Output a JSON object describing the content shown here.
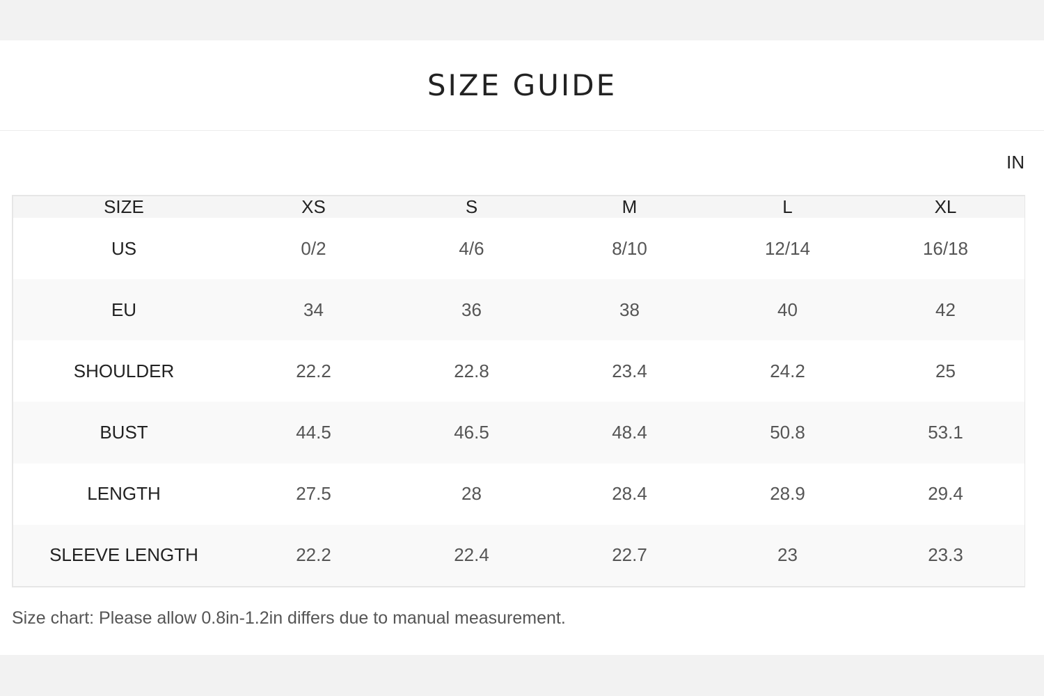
{
  "page": {
    "title": "SIZE GUIDE",
    "unit": "IN"
  },
  "table": {
    "headers": [
      "SIZE",
      "XS",
      "S",
      "M",
      "L",
      "XL"
    ],
    "rows": [
      {
        "label": "US",
        "values": [
          "0/2",
          "4/6",
          "8/10",
          "12/14",
          "16/18"
        ]
      },
      {
        "label": "EU",
        "values": [
          "34",
          "36",
          "38",
          "40",
          "42"
        ]
      },
      {
        "label": "SHOULDER",
        "values": [
          "22.2",
          "22.8",
          "23.4",
          "24.2",
          "25"
        ]
      },
      {
        "label": "BUST",
        "values": [
          "44.5",
          "46.5",
          "48.4",
          "50.8",
          "53.1"
        ]
      },
      {
        "label": "LENGTH",
        "values": [
          "27.5",
          "28",
          "28.4",
          "28.9",
          "29.4"
        ]
      },
      {
        "label": "SLEEVE LENGTH",
        "values": [
          "22.2",
          "22.4",
          "22.7",
          "23",
          "23.3"
        ]
      }
    ]
  },
  "note": "Size chart: Please allow 0.8in-1.2in differs due to manual measurement.",
  "colors": {
    "page_bg": "#f2f2f2",
    "panel_bg": "#ffffff",
    "header_row_bg": "#f5f5f5",
    "alt_row_bg": "#f9f9f9",
    "border": "#e6e6e6",
    "text_dark": "#222222",
    "text_muted": "#555555"
  }
}
